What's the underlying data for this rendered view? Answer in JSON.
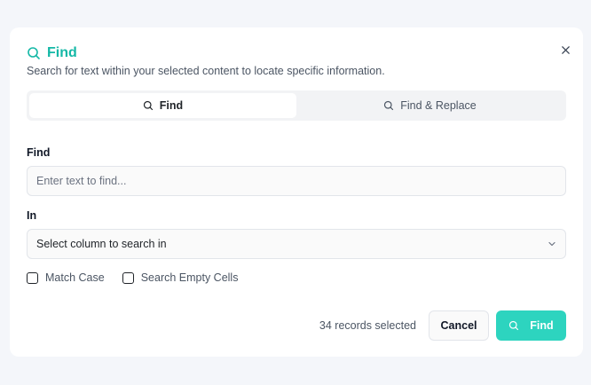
{
  "dialog": {
    "title": "Find",
    "subtitle": "Search for text within your selected content to locate specific information.",
    "close_icon": "close-icon",
    "accent": "#14b8a6"
  },
  "tabs": [
    {
      "label": "Find",
      "icon": "search-icon",
      "active": true
    },
    {
      "label": "Find & Replace",
      "icon": "search-icon",
      "active": false
    }
  ],
  "find_field": {
    "label": "Find",
    "value": "",
    "placeholder": "Enter text to find..."
  },
  "in_field": {
    "label": "In",
    "selected": "Select column to search in",
    "icon": "chevron-down-icon"
  },
  "options": [
    {
      "label": "Match Case",
      "checked": false
    },
    {
      "label": "Search Empty Cells",
      "checked": false
    }
  ],
  "footer": {
    "count_text": "34 records selected",
    "cancel_label": "Cancel",
    "find_label": "Find",
    "primary_color": "#2dd4bf"
  }
}
